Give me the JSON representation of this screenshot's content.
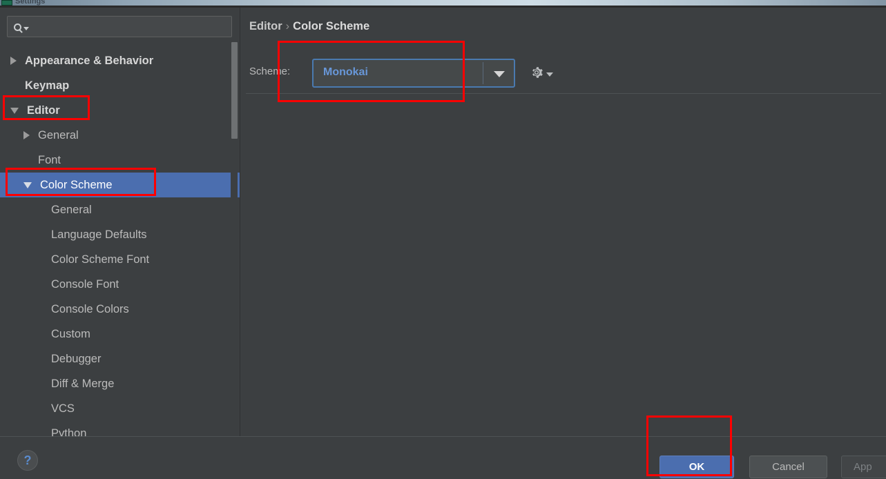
{
  "window": {
    "title": "Settings",
    "icon": "app-icon"
  },
  "search": {
    "value": "",
    "placeholder": "",
    "icon": "search-icon"
  },
  "sidebar": {
    "items": [
      {
        "label": "Appearance & Behavior",
        "level": 0,
        "arrow": "collapsed",
        "bold": true,
        "selected": false
      },
      {
        "label": "Keymap",
        "level": 0,
        "arrow": "none",
        "bold": true,
        "selected": false
      },
      {
        "label": "Editor",
        "level": 0,
        "arrow": "expanded",
        "bold": true,
        "selected": false
      },
      {
        "label": "General",
        "level": 1,
        "arrow": "collapsed",
        "bold": false,
        "selected": false
      },
      {
        "label": "Font",
        "level": 1,
        "arrow": "none",
        "bold": false,
        "selected": false
      },
      {
        "label": "Color Scheme",
        "level": 1,
        "arrow": "expanded",
        "bold": false,
        "selected": true
      },
      {
        "label": "General",
        "level": 2,
        "arrow": "none",
        "bold": false,
        "selected": false
      },
      {
        "label": "Language Defaults",
        "level": 2,
        "arrow": "none",
        "bold": false,
        "selected": false
      },
      {
        "label": "Color Scheme Font",
        "level": 2,
        "arrow": "none",
        "bold": false,
        "selected": false
      },
      {
        "label": "Console Font",
        "level": 2,
        "arrow": "none",
        "bold": false,
        "selected": false
      },
      {
        "label": "Console Colors",
        "level": 2,
        "arrow": "none",
        "bold": false,
        "selected": false
      },
      {
        "label": "Custom",
        "level": 2,
        "arrow": "none",
        "bold": false,
        "selected": false
      },
      {
        "label": "Debugger",
        "level": 2,
        "arrow": "none",
        "bold": false,
        "selected": false
      },
      {
        "label": "Diff & Merge",
        "level": 2,
        "arrow": "none",
        "bold": false,
        "selected": false
      },
      {
        "label": "VCS",
        "level": 2,
        "arrow": "none",
        "bold": false,
        "selected": false
      },
      {
        "label": "Python",
        "level": 2,
        "arrow": "none",
        "bold": false,
        "selected": false
      }
    ]
  },
  "content": {
    "breadcrumb": {
      "root": "Editor",
      "separator": "›",
      "leaf": "Color Scheme"
    },
    "scheme": {
      "label": "Scheme:",
      "value": "Monokai",
      "dropdown_icon": "chevron-down-icon",
      "gear_icon": "gear-icon"
    }
  },
  "footer": {
    "help_label": "?",
    "ok_label": "OK",
    "cancel_label": "Cancel",
    "apply_label": "App"
  },
  "colors": {
    "background": "#3c3f41",
    "selection": "#4b6eaf",
    "accent_text": "#6897d8",
    "annotation": "#fe0000",
    "text": "#bbbbbb"
  }
}
